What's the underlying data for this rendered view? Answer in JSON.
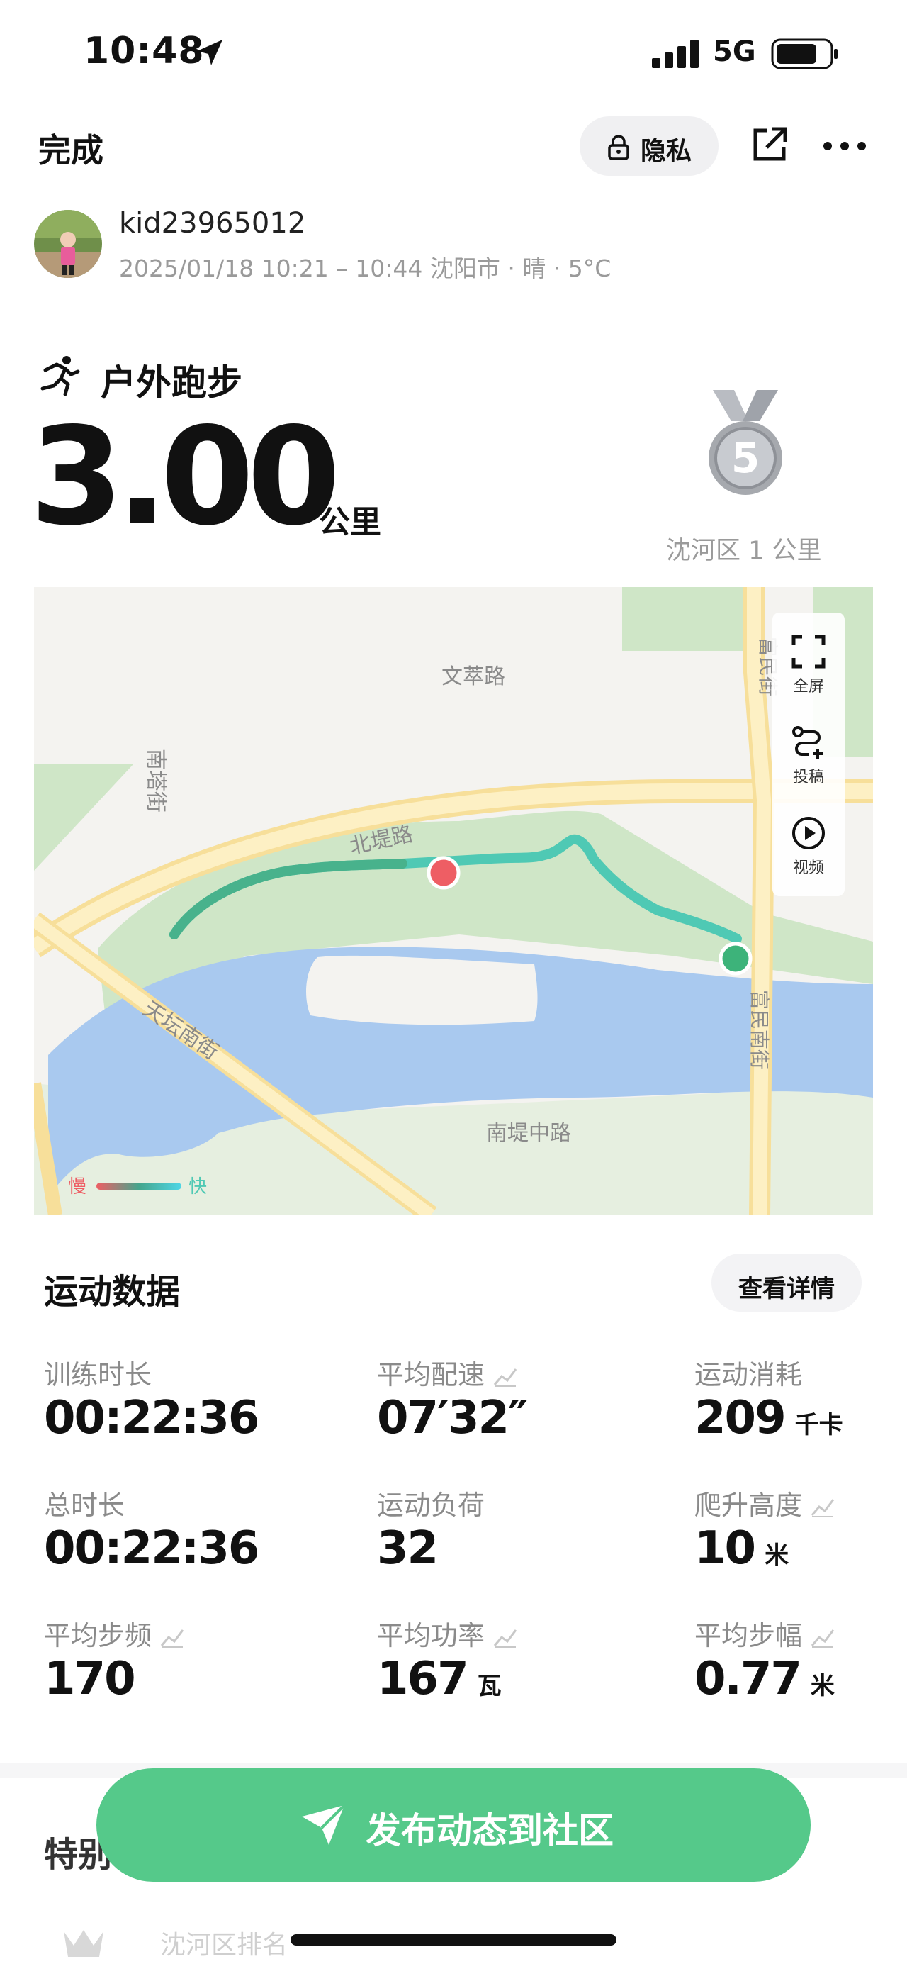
{
  "status_bar": {
    "time": "10:48",
    "network": "5G"
  },
  "header": {
    "done_label": "完成",
    "privacy_label": "隐私"
  },
  "user": {
    "name": "kid23965012",
    "meta": "2025/01/18 10:21 – 10:44 沈阳市 · 晴 · 5°C"
  },
  "activity": {
    "type": "户外跑步",
    "distance": "3.00",
    "unit": "公里",
    "medal_number": "5",
    "medal_label": "沈河区 1 公里"
  },
  "map": {
    "road_labels": [
      "文萃路",
      "南塔街",
      "北堤路",
      "天坛南街",
      "南堤中路",
      "富民街",
      "富民南街"
    ],
    "controls": {
      "fullscreen": "全屏",
      "submit": "投稿",
      "video": "视频"
    },
    "legend": {
      "slow": "慢",
      "fast": "快"
    }
  },
  "stats": {
    "title": "运动数据",
    "detail_button": "查看详情",
    "items": [
      {
        "label": "训练时长",
        "value": "00:22:36",
        "unit": ""
      },
      {
        "label": "平均配速",
        "value": "07′32″",
        "unit": ""
      },
      {
        "label": "运动消耗",
        "value": "209",
        "unit": "千卡"
      },
      {
        "label": "总时长",
        "value": "00:22:36",
        "unit": ""
      },
      {
        "label": "运动负荷",
        "value": "32",
        "unit": ""
      },
      {
        "label": "爬升高度",
        "value": "10",
        "unit": "米"
      },
      {
        "label": "平均步频",
        "value": "170",
        "unit": ""
      },
      {
        "label": "平均功率",
        "value": "167",
        "unit": "瓦"
      },
      {
        "label": "平均步幅",
        "value": "0.77",
        "unit": "米"
      }
    ]
  },
  "section2": {
    "title": "特别",
    "row_text": "沈河区排名"
  },
  "publish_button": "发布动态到社区",
  "colors": {
    "accent": "#55c98a",
    "route": "#4fc9b4",
    "end_marker": "#ee5e64",
    "start_marker": "#3db37a",
    "water": "#a9c9ef"
  }
}
